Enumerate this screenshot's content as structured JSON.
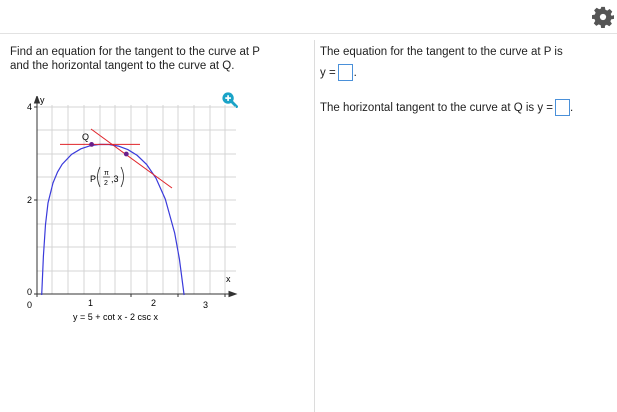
{
  "question": {
    "line1": "Find an equation for the tangent to the curve at P",
    "line2": "and the horizontal tangent to the curve at Q."
  },
  "answer_panel": {
    "p_line1": "The equation for the tangent to the curve at P is",
    "p_prefix": "y =",
    "p_suffix": ".",
    "q_prefix": "The horizontal tangent to the curve at Q is y =",
    "q_suffix": "."
  },
  "graph": {
    "axis_x_label": "x",
    "axis_y_label": "y",
    "y_ticks": [
      "4",
      "2",
      "0"
    ],
    "x_ticks": [
      "0",
      "1",
      "2",
      "3"
    ],
    "point_q_label": "Q",
    "point_p_label": "P",
    "point_p_coord_pi": "π",
    "point_p_coord_den": "2",
    "point_p_coord_y": ",3",
    "caption": "y = 5 + cot x - 2 csc x",
    "colors": {
      "curve": "#3a3adb",
      "tangent": "#e0242a",
      "grid": "#d4d4d4",
      "point": "#6a1f8a"
    }
  },
  "icons": {
    "settings": "gear-icon",
    "zoom": "zoom-in-icon"
  }
}
